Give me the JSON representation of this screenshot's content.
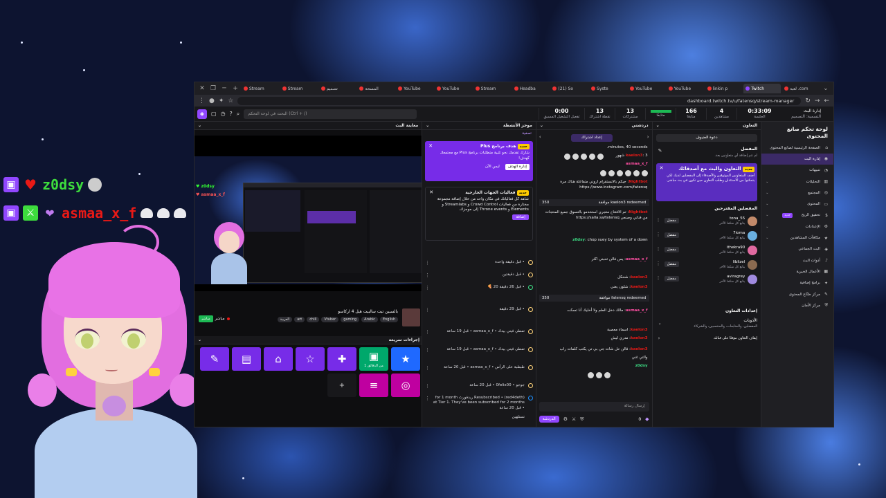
{
  "overlay": {
    "user1": "z0dsy",
    "user2": "asmaa_x_f"
  },
  "browser": {
    "tabs": [
      "Stream",
      "Stream",
      "تصميم",
      "المسحة",
      "YouTube",
      "YouTube",
      "Stream",
      "Headba",
      "(21) So",
      "Syste",
      "YouTube",
      "YouTube",
      "linkin p",
      "Twitch",
      "لعبة .com"
    ],
    "url": "dashboard.twitch.tv/u/fatensq/stream-manager"
  },
  "topbar": {
    "search_placeholder": "البحث في لوحة التحكم (Ctrl + /)",
    "stats": [
      {
        "value": "0:00",
        "label": "تفعيل التشغيل المسبق"
      },
      {
        "value": "13",
        "label": "نقطة اشتراك"
      },
      {
        "value": "13",
        "label": "مشتركات"
      },
      {
        "value": "",
        "label": "معدل البث"
      },
      {
        "value": "166",
        "label": "متابعًا"
      },
      {
        "value": "4",
        "label": "مشاهدين"
      },
      {
        "value": "0:33:09",
        "label": "الجلسة"
      }
    ],
    "brand_line1": "إدارة البث",
    "brand_line2": "التسمية: التصميم"
  },
  "preview": {
    "header": "معاينة البث",
    "stream_title": "بالسبين تبت سالبيت هيل 4 اركاسو",
    "tags": [
      "English",
      "Arabic",
      "gaming",
      "Vtuber",
      "chill",
      "art",
      "العربية"
    ],
    "live_button": "مباشر",
    "live_label": "مباشر"
  },
  "quick_actions": {
    "header": "إجراءات سريعة",
    "buttons": [
      {
        "icon": "★",
        "color": "#1f69ff",
        "label": ""
      },
      {
        "icon": "▣",
        "color": "#00a86b",
        "label": "1 من الدقائق"
      },
      {
        "icon": "✚",
        "color": "#772ce8",
        "label": ""
      },
      {
        "icon": "☆",
        "color": "#772ce8",
        "label": ""
      },
      {
        "icon": "⌂",
        "color": "#772ce8",
        "label": ""
      },
      {
        "icon": "▤",
        "color": "#772ce8",
        "label": ""
      },
      {
        "icon": "✎",
        "color": "#772ce8",
        "label": ""
      }
    ],
    "row2": [
      {
        "icon": "+",
        "color": "#18181b"
      },
      {
        "icon": "≡",
        "color": "#bf00a0"
      },
      {
        "icon": "◎",
        "color": "#bf00a0"
      }
    ]
  },
  "activity": {
    "header": "موجز الأنشطة",
    "filter": "تصفية",
    "card1": {
      "title": "هدف برنامج Plus",
      "body": "شارك تقدمك نحو تلبية متطلبات برنامج Plus مع مجتمعك كهدف!",
      "btn1": "إدارة الهدف",
      "btn2": "ليس الآن",
      "new": "جديد"
    },
    "card2": {
      "title": "فعاليات الجهات الخارجية",
      "body": "شاهد كل فعالياتك في مكان واحد من خلال إضافة مجموعة مختارة من فعاليات Crowd Control و Streamlabs و Elements و Throne events إلى موجزك.",
      "btn": "إضافة",
      "new": "جديد"
    },
    "items": [
      "• قبل دقيقة واحدة",
      "• قبل دقيقتين",
      "• قبل 26 دقيقة  20 🍕",
      "• قبل 29 دقيقة",
      "تمطي فيني بيدك • asmaa_x_f • قبل 19 ساعة",
      "تمطي فيني بيدك • asmaa_x_f • قبل 19 ساعة",
      "طبطبة على الرأس • asmaa_x_f • قبل 20 ساعة",
      "جوجو • 0felix00 • قبل 20 ساعة",
      "Resubscribed • (red4deth) ريدفورث for 1 month at Tier 1. They've been subscribed for 2 months • قبل 20 ساعة"
    ],
    "last_line": "تستلهين"
  },
  "chat": {
    "header": "دردشتي",
    "sub_button": "إعداد اشتراك",
    "lines": [
      {
        "name": "",
        "text": "minutes, 40 seconds."
      },
      {
        "name": "kaelon3",
        "text": "3 شهور"
      },
      {
        "name": "asmaa_x_f",
        "text": ""
      },
      {
        "name": "Nightbot",
        "text": "جيكم بالانستقرام اروني متفاعلة هناك مرة https://www.instagram.com/fatensq"
      },
      {
        "name": "",
        "text": "kaelon3 redeemed موافقة",
        "points": "350"
      },
      {
        "name": "Nightbot",
        "text": "تم الافتتاح متجري استخدمو بالتسوق جميع المنتجات من فناني وصنعي https://salla.sa/fatensq"
      },
      {
        "name": "z0dsy",
        "text": "chop suey by system of a down"
      },
      {
        "name": "asmaa_x_f",
        "text": "يس فالن تحبني اكثر"
      },
      {
        "name": "kaelon3",
        "text": "شحكل"
      },
      {
        "name": "kaelon3",
        "text": "شلون يعني"
      },
      {
        "name": "",
        "text": "fatensq redeemed موافقة",
        "points": "350"
      },
      {
        "name": "asmaa_x_f",
        "text": "مالك دخل الطم ولا أخليك آنا تسكت"
      },
      {
        "name": "kaelon3",
        "text": "اسماء معصبة"
      },
      {
        "name": "kaelon3",
        "text": "مدري ليش"
      },
      {
        "name": "kaelon3",
        "text": "فالن حل شات جي بي تي يكتب كلمات راب"
      },
      {
        "name": "",
        "text": "والتي غني"
      },
      {
        "name": "z0dsy",
        "text": ""
      }
    ],
    "input_placeholder": "إرسال رسالة",
    "chat_button": "الدردشة",
    "points": "0"
  },
  "collab": {
    "header": "التعاون",
    "guest_button": "دعوة الضيوف",
    "favorite_title": "المفضل",
    "favorite_sub": "لم تتم إضافة أي متعاونين بعد.",
    "promo_title": "التعاون والبث مع أصدقائك",
    "promo_body": "أضف المتعاونين الموثوقين والأصدقاء إلى المفضلين لديك لكي يتمكنوا من الاستئذان وطلب التعاون حين تكون في بث مباشر.",
    "promo_new": "جديد",
    "suggested_title": "المفضلين المقترحين",
    "favorites": [
      {
        "name": "tona_55",
        "status": "يتابع كل منكما الآخر",
        "btn": "مفضل",
        "color": "#c28a6a"
      },
      {
        "name": "7ioma",
        "status": "يتابع كل منكما الآخر",
        "btn": "مفضل",
        "color": "#6ab0e0"
      },
      {
        "name": "ithekra90",
        "status": "يتابع كل منكما الآخر",
        "btn": "مفضل",
        "color": "#e06aa0"
      },
      {
        "name": "liblizel",
        "status": "يتابع كل منكما الآخر",
        "btn": "مفضل",
        "color": "#8a6a50"
      },
      {
        "name": "aviragrey",
        "status": "يتابع كل منكما الآخر",
        "btn": "مفضل",
        "color": "#a08adf"
      }
    ],
    "settings_title": "إعدادات التعاون",
    "perm_title": "الأذونات",
    "perm_sub": "المفضلين، والمتابعات، والمنتسبين، والشركاء",
    "pause": "إيقاف التعاون مؤقتًا على قناتك"
  },
  "sidebar": {
    "title": "لوحة تحكم صانع المحتوى",
    "items": [
      {
        "icon": "⌂",
        "label": "الصفحة الرئيسية لصانع المحتوى",
        "active": false,
        "chev": false
      },
      {
        "icon": "((•))",
        "label": "إدارة البث",
        "active": true,
        "chev": false
      },
      {
        "icon": "🔔",
        "label": "تنبيهات",
        "active": false,
        "chev": false
      },
      {
        "icon": "▥",
        "label": "التحليلات",
        "active": false,
        "chev": true
      },
      {
        "icon": "◉",
        "label": "المجتمع",
        "active": false,
        "chev": true
      },
      {
        "icon": "▭",
        "label": "المحتوى",
        "active": false,
        "chev": true
      },
      {
        "icon": "$",
        "label": "تحقيق الربح",
        "active": false,
        "chev": true,
        "new": "جديد"
      },
      {
        "icon": "⚙",
        "label": "الإعدادات",
        "active": false,
        "chev": true
      },
      {
        "icon": "★",
        "label": "مكافآت المشاهدين",
        "active": false,
        "chev": true
      },
      {
        "icon": "◈",
        "label": "البث الجماعي",
        "active": false,
        "chev": false
      },
      {
        "icon": "♪",
        "label": "أدوات البث",
        "active": false,
        "chev": false
      },
      {
        "icon": "▦",
        "label": "الأعمال الخيرية",
        "active": false,
        "chev": false
      },
      {
        "icon": "✦",
        "label": "برامج إضافية",
        "active": false,
        "chev": false
      },
      {
        "icon": "✎",
        "label": "مركز صُنّاع المحتوى",
        "active": false,
        "chev": false
      },
      {
        "icon": "⛨",
        "label": "مركز الأمان",
        "active": false,
        "chev": false
      }
    ]
  }
}
